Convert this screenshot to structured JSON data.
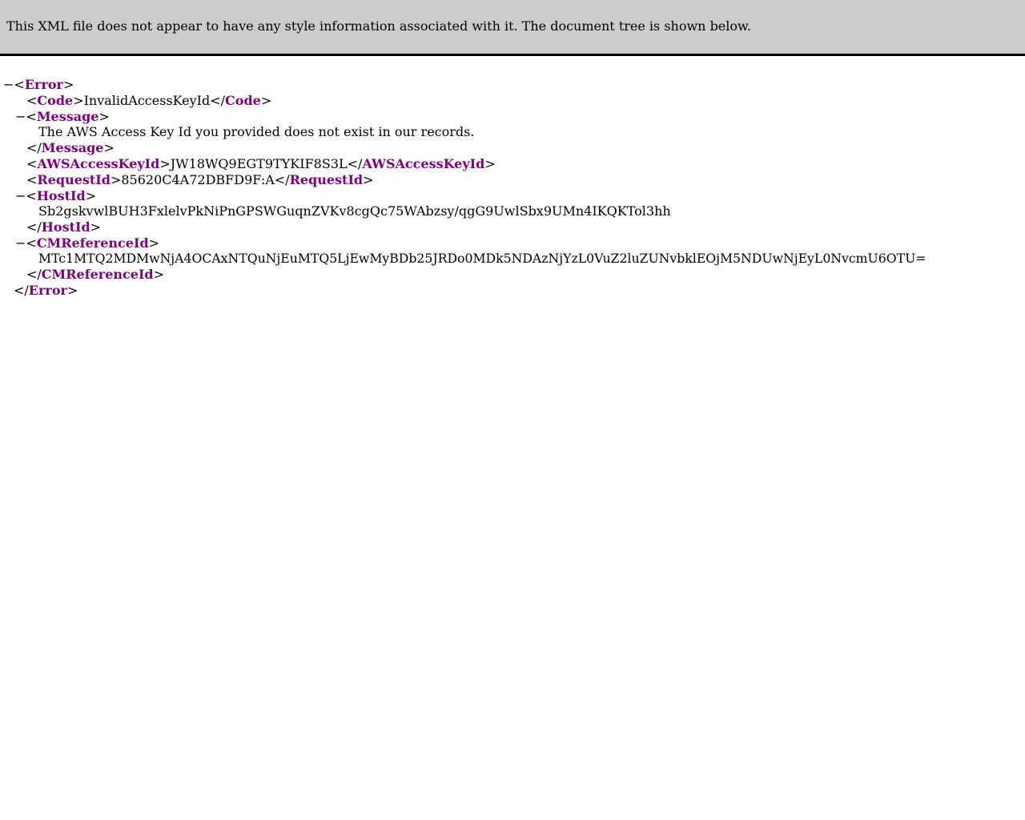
{
  "banner": {
    "message": "This XML file does not appear to have any style information associated with it. The document tree is shown below."
  },
  "tree": {
    "toggle_symbol": "−",
    "root": {
      "tag": "Error"
    },
    "code": {
      "tag": "Code",
      "value": "InvalidAccessKeyId"
    },
    "message": {
      "tag": "Message",
      "value": "The AWS Access Key Id you provided does not exist in our records."
    },
    "aws_access_key_id": {
      "tag": "AWSAccessKeyId",
      "value": "JW18WQ9EGT9TYKIF8S3L"
    },
    "request_id": {
      "tag": "RequestId",
      "value": "85620C4A72DBFD9F:A"
    },
    "host_id": {
      "tag": "HostId",
      "value": "Sb2gskvwlBUH3FxlelvPkNiPnGPSWGuqnZVKv8cgQc75WAbzsy/qgG9UwlSbx9UMn4IKQKTol3hh"
    },
    "cm_reference_id": {
      "tag": "CMReferenceId",
      "value": "MTc1MTQ2MDMwNjA4OCAxNTQuNjEuMTQ5LjEwMyBDb25JRDo0MDk5NDAzNjYzL0VuZ2luZUNvbklEOjM5NDUwNjEyL0NvcmU6OTU="
    }
  },
  "colors": {
    "banner_background": "#cccccc",
    "tag_name": "#800080"
  }
}
